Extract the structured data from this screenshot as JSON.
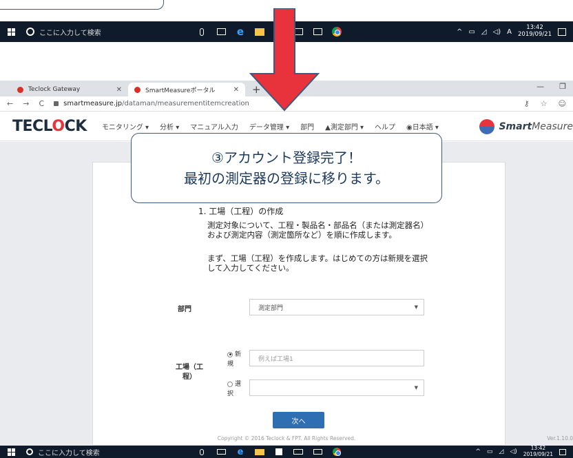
{
  "taskbar": {
    "search_placeholder": "ここに入力して検索",
    "time": "13:42",
    "date": "2019/09/21",
    "ime": "A"
  },
  "taskbar_bottom": {
    "search_placeholder": "ここに入力して検索",
    "time": "13:42",
    "date": "2019/09/21"
  },
  "browser": {
    "tabs": [
      {
        "title": "Teclock Gateway"
      },
      {
        "title": "SmartMeasureポータル"
      }
    ],
    "url_host": "smartmeasure.jp",
    "url_path": "/dataman/measurementitemcreation"
  },
  "app": {
    "logo_pre": "TECL",
    "logo_o": "O",
    "logo_post": "CK",
    "menu": [
      "モニタリング ▾",
      "分析 ▾",
      "マニュアル入力",
      "データ管理 ▾",
      "部門",
      "▲測定部門 ▾",
      "ヘルプ",
      "◉日本語 ▾"
    ],
    "brand_bold": "Smart",
    "brand_light": "Measure"
  },
  "callout": {
    "line1": "③アカウント登録完了！",
    "line2": "最初の測定器の登録に移ります。"
  },
  "form": {
    "section_title": "1. 工場（工程）の作成",
    "desc1": "測定対象について、工程・製品名・部品名（または測定器名）および測定内容（測定箇所など）を順に作成します。",
    "desc2": "まず、工場（工程）を作成します。はじめての方は新規を選択して入力してください。",
    "department_label": "部門",
    "department_value": "測定部門",
    "factory_label": "工場（工程）",
    "radio_new": "新規",
    "radio_select": "選択",
    "factory_placeholder": "例えば工場1",
    "next_button": "次へ"
  },
  "footer": {
    "copyright": "Copyright © 2016 Teclock & FPT. All Rights Reserved.",
    "version": "Ver.1.10.0"
  },
  "colors": {
    "accent_red": "#e8323c",
    "button_blue": "#2e6fb3",
    "callout_border": "#3d5a80"
  }
}
